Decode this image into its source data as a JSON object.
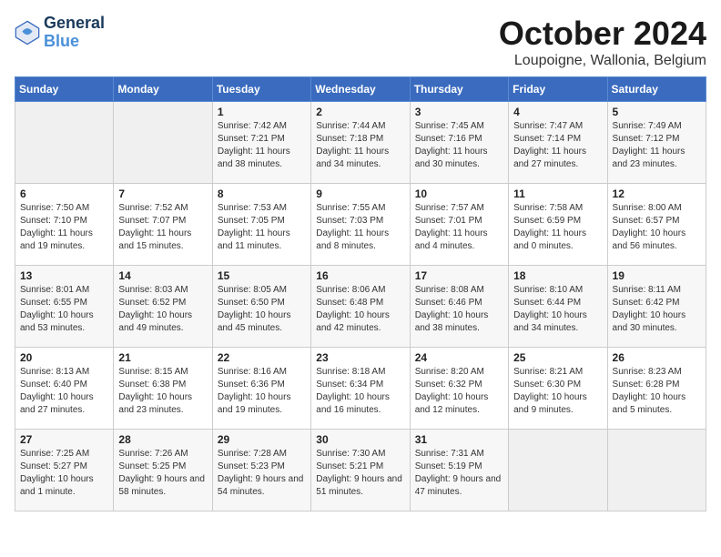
{
  "logo": {
    "line1": "General",
    "line2": "Blue"
  },
  "title": "October 2024",
  "subtitle": "Loupoigne, Wallonia, Belgium",
  "headers": [
    "Sunday",
    "Monday",
    "Tuesday",
    "Wednesday",
    "Thursday",
    "Friday",
    "Saturday"
  ],
  "weeks": [
    [
      {
        "day": "",
        "sunrise": "",
        "sunset": "",
        "daylight": ""
      },
      {
        "day": "",
        "sunrise": "",
        "sunset": "",
        "daylight": ""
      },
      {
        "day": "1",
        "sunrise": "Sunrise: 7:42 AM",
        "sunset": "Sunset: 7:21 PM",
        "daylight": "Daylight: 11 hours and 38 minutes."
      },
      {
        "day": "2",
        "sunrise": "Sunrise: 7:44 AM",
        "sunset": "Sunset: 7:18 PM",
        "daylight": "Daylight: 11 hours and 34 minutes."
      },
      {
        "day": "3",
        "sunrise": "Sunrise: 7:45 AM",
        "sunset": "Sunset: 7:16 PM",
        "daylight": "Daylight: 11 hours and 30 minutes."
      },
      {
        "day": "4",
        "sunrise": "Sunrise: 7:47 AM",
        "sunset": "Sunset: 7:14 PM",
        "daylight": "Daylight: 11 hours and 27 minutes."
      },
      {
        "day": "5",
        "sunrise": "Sunrise: 7:49 AM",
        "sunset": "Sunset: 7:12 PM",
        "daylight": "Daylight: 11 hours and 23 minutes."
      }
    ],
    [
      {
        "day": "6",
        "sunrise": "Sunrise: 7:50 AM",
        "sunset": "Sunset: 7:10 PM",
        "daylight": "Daylight: 11 hours and 19 minutes."
      },
      {
        "day": "7",
        "sunrise": "Sunrise: 7:52 AM",
        "sunset": "Sunset: 7:07 PM",
        "daylight": "Daylight: 11 hours and 15 minutes."
      },
      {
        "day": "8",
        "sunrise": "Sunrise: 7:53 AM",
        "sunset": "Sunset: 7:05 PM",
        "daylight": "Daylight: 11 hours and 11 minutes."
      },
      {
        "day": "9",
        "sunrise": "Sunrise: 7:55 AM",
        "sunset": "Sunset: 7:03 PM",
        "daylight": "Daylight: 11 hours and 8 minutes."
      },
      {
        "day": "10",
        "sunrise": "Sunrise: 7:57 AM",
        "sunset": "Sunset: 7:01 PM",
        "daylight": "Daylight: 11 hours and 4 minutes."
      },
      {
        "day": "11",
        "sunrise": "Sunrise: 7:58 AM",
        "sunset": "Sunset: 6:59 PM",
        "daylight": "Daylight: 11 hours and 0 minutes."
      },
      {
        "day": "12",
        "sunrise": "Sunrise: 8:00 AM",
        "sunset": "Sunset: 6:57 PM",
        "daylight": "Daylight: 10 hours and 56 minutes."
      }
    ],
    [
      {
        "day": "13",
        "sunrise": "Sunrise: 8:01 AM",
        "sunset": "Sunset: 6:55 PM",
        "daylight": "Daylight: 10 hours and 53 minutes."
      },
      {
        "day": "14",
        "sunrise": "Sunrise: 8:03 AM",
        "sunset": "Sunset: 6:52 PM",
        "daylight": "Daylight: 10 hours and 49 minutes."
      },
      {
        "day": "15",
        "sunrise": "Sunrise: 8:05 AM",
        "sunset": "Sunset: 6:50 PM",
        "daylight": "Daylight: 10 hours and 45 minutes."
      },
      {
        "day": "16",
        "sunrise": "Sunrise: 8:06 AM",
        "sunset": "Sunset: 6:48 PM",
        "daylight": "Daylight: 10 hours and 42 minutes."
      },
      {
        "day": "17",
        "sunrise": "Sunrise: 8:08 AM",
        "sunset": "Sunset: 6:46 PM",
        "daylight": "Daylight: 10 hours and 38 minutes."
      },
      {
        "day": "18",
        "sunrise": "Sunrise: 8:10 AM",
        "sunset": "Sunset: 6:44 PM",
        "daylight": "Daylight: 10 hours and 34 minutes."
      },
      {
        "day": "19",
        "sunrise": "Sunrise: 8:11 AM",
        "sunset": "Sunset: 6:42 PM",
        "daylight": "Daylight: 10 hours and 30 minutes."
      }
    ],
    [
      {
        "day": "20",
        "sunrise": "Sunrise: 8:13 AM",
        "sunset": "Sunset: 6:40 PM",
        "daylight": "Daylight: 10 hours and 27 minutes."
      },
      {
        "day": "21",
        "sunrise": "Sunrise: 8:15 AM",
        "sunset": "Sunset: 6:38 PM",
        "daylight": "Daylight: 10 hours and 23 minutes."
      },
      {
        "day": "22",
        "sunrise": "Sunrise: 8:16 AM",
        "sunset": "Sunset: 6:36 PM",
        "daylight": "Daylight: 10 hours and 19 minutes."
      },
      {
        "day": "23",
        "sunrise": "Sunrise: 8:18 AM",
        "sunset": "Sunset: 6:34 PM",
        "daylight": "Daylight: 10 hours and 16 minutes."
      },
      {
        "day": "24",
        "sunrise": "Sunrise: 8:20 AM",
        "sunset": "Sunset: 6:32 PM",
        "daylight": "Daylight: 10 hours and 12 minutes."
      },
      {
        "day": "25",
        "sunrise": "Sunrise: 8:21 AM",
        "sunset": "Sunset: 6:30 PM",
        "daylight": "Daylight: 10 hours and 9 minutes."
      },
      {
        "day": "26",
        "sunrise": "Sunrise: 8:23 AM",
        "sunset": "Sunset: 6:28 PM",
        "daylight": "Daylight: 10 hours and 5 minutes."
      }
    ],
    [
      {
        "day": "27",
        "sunrise": "Sunrise: 7:25 AM",
        "sunset": "Sunset: 5:27 PM",
        "daylight": "Daylight: 10 hours and 1 minute."
      },
      {
        "day": "28",
        "sunrise": "Sunrise: 7:26 AM",
        "sunset": "Sunset: 5:25 PM",
        "daylight": "Daylight: 9 hours and 58 minutes."
      },
      {
        "day": "29",
        "sunrise": "Sunrise: 7:28 AM",
        "sunset": "Sunset: 5:23 PM",
        "daylight": "Daylight: 9 hours and 54 minutes."
      },
      {
        "day": "30",
        "sunrise": "Sunrise: 7:30 AM",
        "sunset": "Sunset: 5:21 PM",
        "daylight": "Daylight: 9 hours and 51 minutes."
      },
      {
        "day": "31",
        "sunrise": "Sunrise: 7:31 AM",
        "sunset": "Sunset: 5:19 PM",
        "daylight": "Daylight: 9 hours and 47 minutes."
      },
      {
        "day": "",
        "sunrise": "",
        "sunset": "",
        "daylight": ""
      },
      {
        "day": "",
        "sunrise": "",
        "sunset": "",
        "daylight": ""
      }
    ]
  ]
}
